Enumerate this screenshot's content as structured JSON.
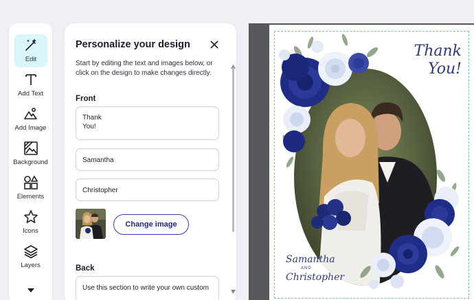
{
  "sidebar": {
    "tools": [
      {
        "label": "Edit",
        "icon": "magic-wand-icon",
        "active": true
      },
      {
        "label": "Add Text",
        "icon": "text-icon"
      },
      {
        "label": "Add Image",
        "icon": "image-add-icon"
      },
      {
        "label": "Background",
        "icon": "background-icon"
      },
      {
        "label": "Elements",
        "icon": "shapes-icon"
      },
      {
        "label": "Icons",
        "icon": "star-icon"
      },
      {
        "label": "Layers",
        "icon": "layers-icon"
      }
    ],
    "more_icon": "caret-down-icon"
  },
  "panel": {
    "title": "Personalize your design",
    "description": "Start by editing the text and images below, or click on the design to make changes directly.",
    "front_label": "Front",
    "fields": {
      "thank": "Thank\nYou!",
      "name1": "Samantha",
      "name2": "Christopher"
    },
    "change_image_label": "Change image",
    "back_label": "Back",
    "back_field": "Use this section to write your own custom"
  },
  "card": {
    "thank_line1": "Thank",
    "thank_line2": "You!",
    "name1": "Samantha",
    "and_text": "AND",
    "name2": "Christopher"
  },
  "colors": {
    "accent": "#23258a",
    "active_tool_bg": "#d8f6fb",
    "script_text": "#2f3a7a",
    "canvas_bg": "#56585c"
  }
}
